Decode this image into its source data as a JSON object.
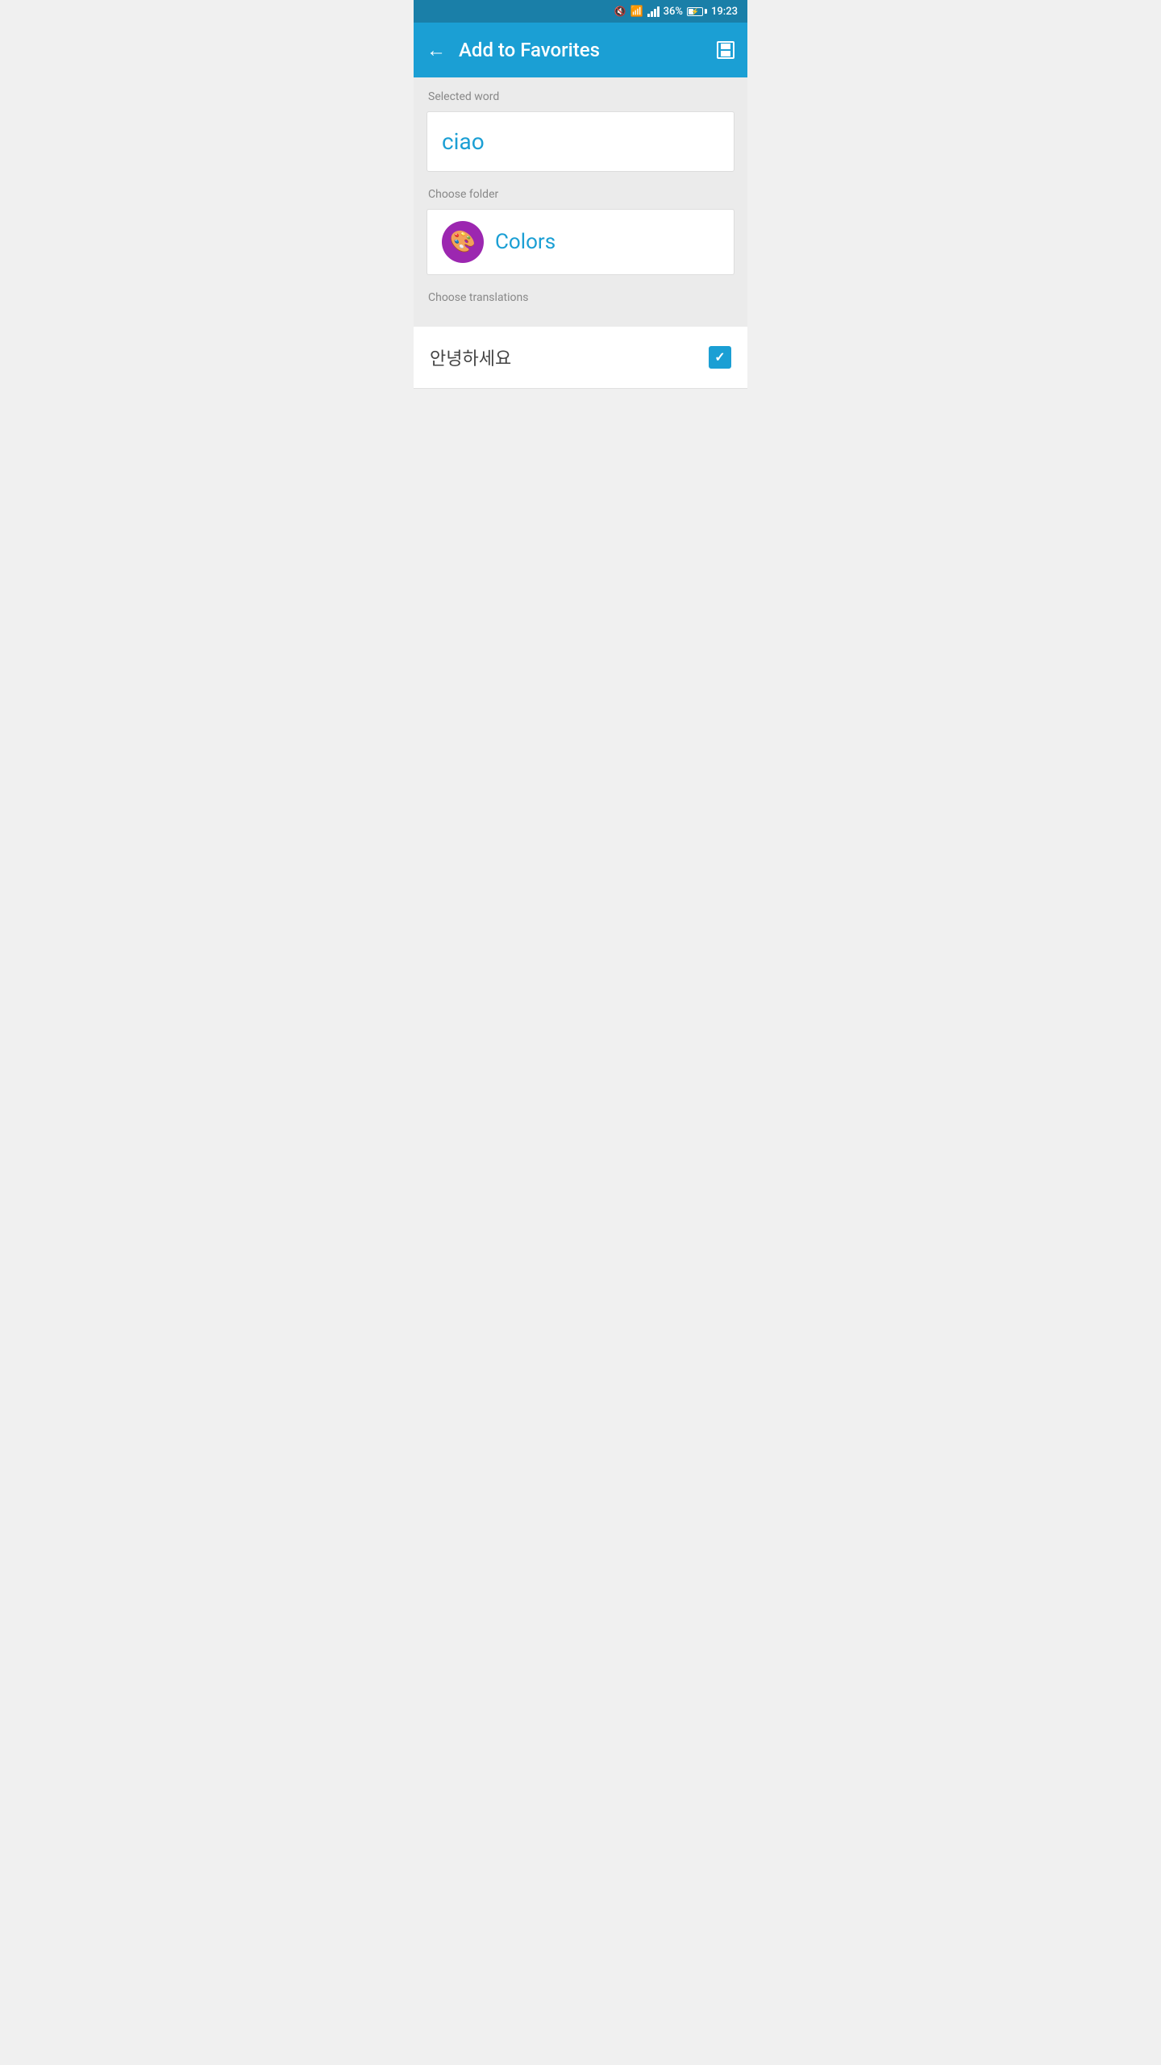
{
  "statusBar": {
    "battery": "36%",
    "time": "19:23"
  },
  "appBar": {
    "title": "Add to Favorites",
    "backLabel": "←",
    "saveLabel": "💾"
  },
  "selectedWordSection": {
    "label": "Selected word",
    "word": "ciao"
  },
  "chooseFolderSection": {
    "label": "Choose folder",
    "folderName": "Colors",
    "folderIconColor": "#9c27b0"
  },
  "chooseTranslationsSection": {
    "label": "Choose translations",
    "translations": [
      {
        "text": "안녕하세요",
        "checked": true
      }
    ]
  }
}
